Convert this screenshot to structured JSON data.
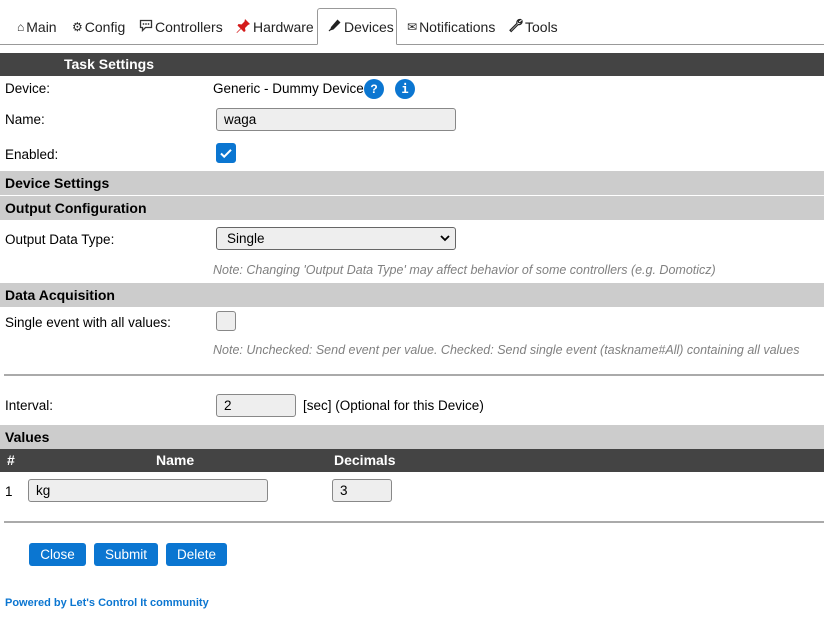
{
  "tabs": [
    {
      "label": "Main",
      "icon": "home-icon",
      "glyph": "⌂"
    },
    {
      "label": "Config",
      "icon": "gear-icon",
      "glyph": "⚙"
    },
    {
      "label": "Controllers",
      "icon": "chat-icon",
      "glyph": ""
    },
    {
      "label": "Hardware",
      "icon": "pushpin-icon",
      "glyph": ""
    },
    {
      "label": "Devices",
      "icon": "pen-icon",
      "glyph": ""
    },
    {
      "label": "Notifications",
      "icon": "envelope-icon",
      "glyph": "✉"
    },
    {
      "label": "Tools",
      "icon": "wrench-icon",
      "glyph": ""
    }
  ],
  "active_tab": "Devices",
  "task_settings": {
    "header": "Task Settings",
    "device_label": "Device:",
    "device_value": "Generic - Dummy Device",
    "help_glyph": "?",
    "info_glyph": "i",
    "name_label": "Name:",
    "name_value": "waga",
    "enabled_label": "Enabled:",
    "enabled": true
  },
  "device_settings": {
    "header": "Device Settings"
  },
  "output_config": {
    "header": "Output Configuration",
    "data_type_label": "Output Data Type:",
    "data_type_value": "Single",
    "note": "Note: Changing 'Output Data Type' may affect behavior of some controllers (e.g. Domoticz)"
  },
  "data_acquisition": {
    "header": "Data Acquisition",
    "single_event_label": "Single event with all values:",
    "single_event_checked": false,
    "note": "Note: Unchecked: Send event per value. Checked: Send single event (taskname#All) containing all values",
    "interval_label": "Interval:",
    "interval_value": "2",
    "interval_suffix": "[sec] (Optional for this Device)"
  },
  "values": {
    "header": "Values",
    "columns": [
      "#",
      "Name",
      "Decimals"
    ],
    "rows": [
      {
        "index": "1",
        "name": "kg",
        "decimals": "3"
      }
    ]
  },
  "buttons": {
    "close": "Close",
    "submit": "Submit",
    "delete": "Delete"
  },
  "footer": {
    "text": "Powered by Let's Control It community"
  },
  "colors": {
    "accent": "#0b76d1",
    "header_dark": "#444444",
    "header_grey": "#cccccc",
    "note_text": "#808080"
  }
}
